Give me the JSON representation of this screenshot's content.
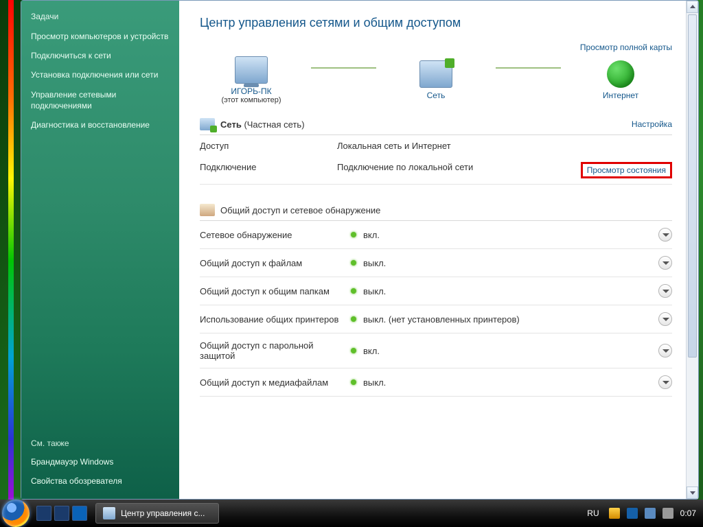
{
  "sidebar": {
    "heading": "Задачи",
    "tasks": [
      "Просмотр компьютеров и устройств",
      "Подключиться к сети",
      "Установка подключения или сети",
      "Управление сетевыми подключениями",
      "Диагностика и восстановление"
    ],
    "see_also_heading": "См. также",
    "see_also": [
      "Брандмауэр Windows",
      "Свойства обозревателя"
    ]
  },
  "page_title": "Центр управления сетями и общим доступом",
  "map_link": "Просмотр полной карты",
  "nodes": {
    "pc_name": "ИГОРЬ-ПК",
    "pc_sub": "(этот компьютер)",
    "network": "Сеть",
    "internet": "Интернет"
  },
  "network_section": {
    "title_prefix": "Сеть",
    "title_paren": "(Частная сеть)",
    "configure": "Настройка",
    "rows": [
      {
        "k": "Доступ",
        "v": "Локальная сеть и Интернет",
        "action": ""
      },
      {
        "k": "Подключение",
        "v": "Подключение по локальной сети",
        "action": "Просмотр состояния"
      }
    ]
  },
  "sharing_heading": "Общий доступ и сетевое обнаружение",
  "settings": [
    {
      "label": "Сетевое обнаружение",
      "value": "вкл."
    },
    {
      "label": "Общий доступ к файлам",
      "value": "выкл."
    },
    {
      "label": "Общий доступ к общим папкам",
      "value": "выкл."
    },
    {
      "label": "Использование общих принтеров",
      "value": "выкл. (нет установленных принтеров)"
    },
    {
      "label": "Общий доступ с парольной защитой",
      "value": "вкл."
    },
    {
      "label": "Общий доступ к медиафайлам",
      "value": "выкл."
    }
  ],
  "taskbar": {
    "app_title": "Центр управления с...",
    "lang": "RU",
    "clock": "0:07"
  }
}
